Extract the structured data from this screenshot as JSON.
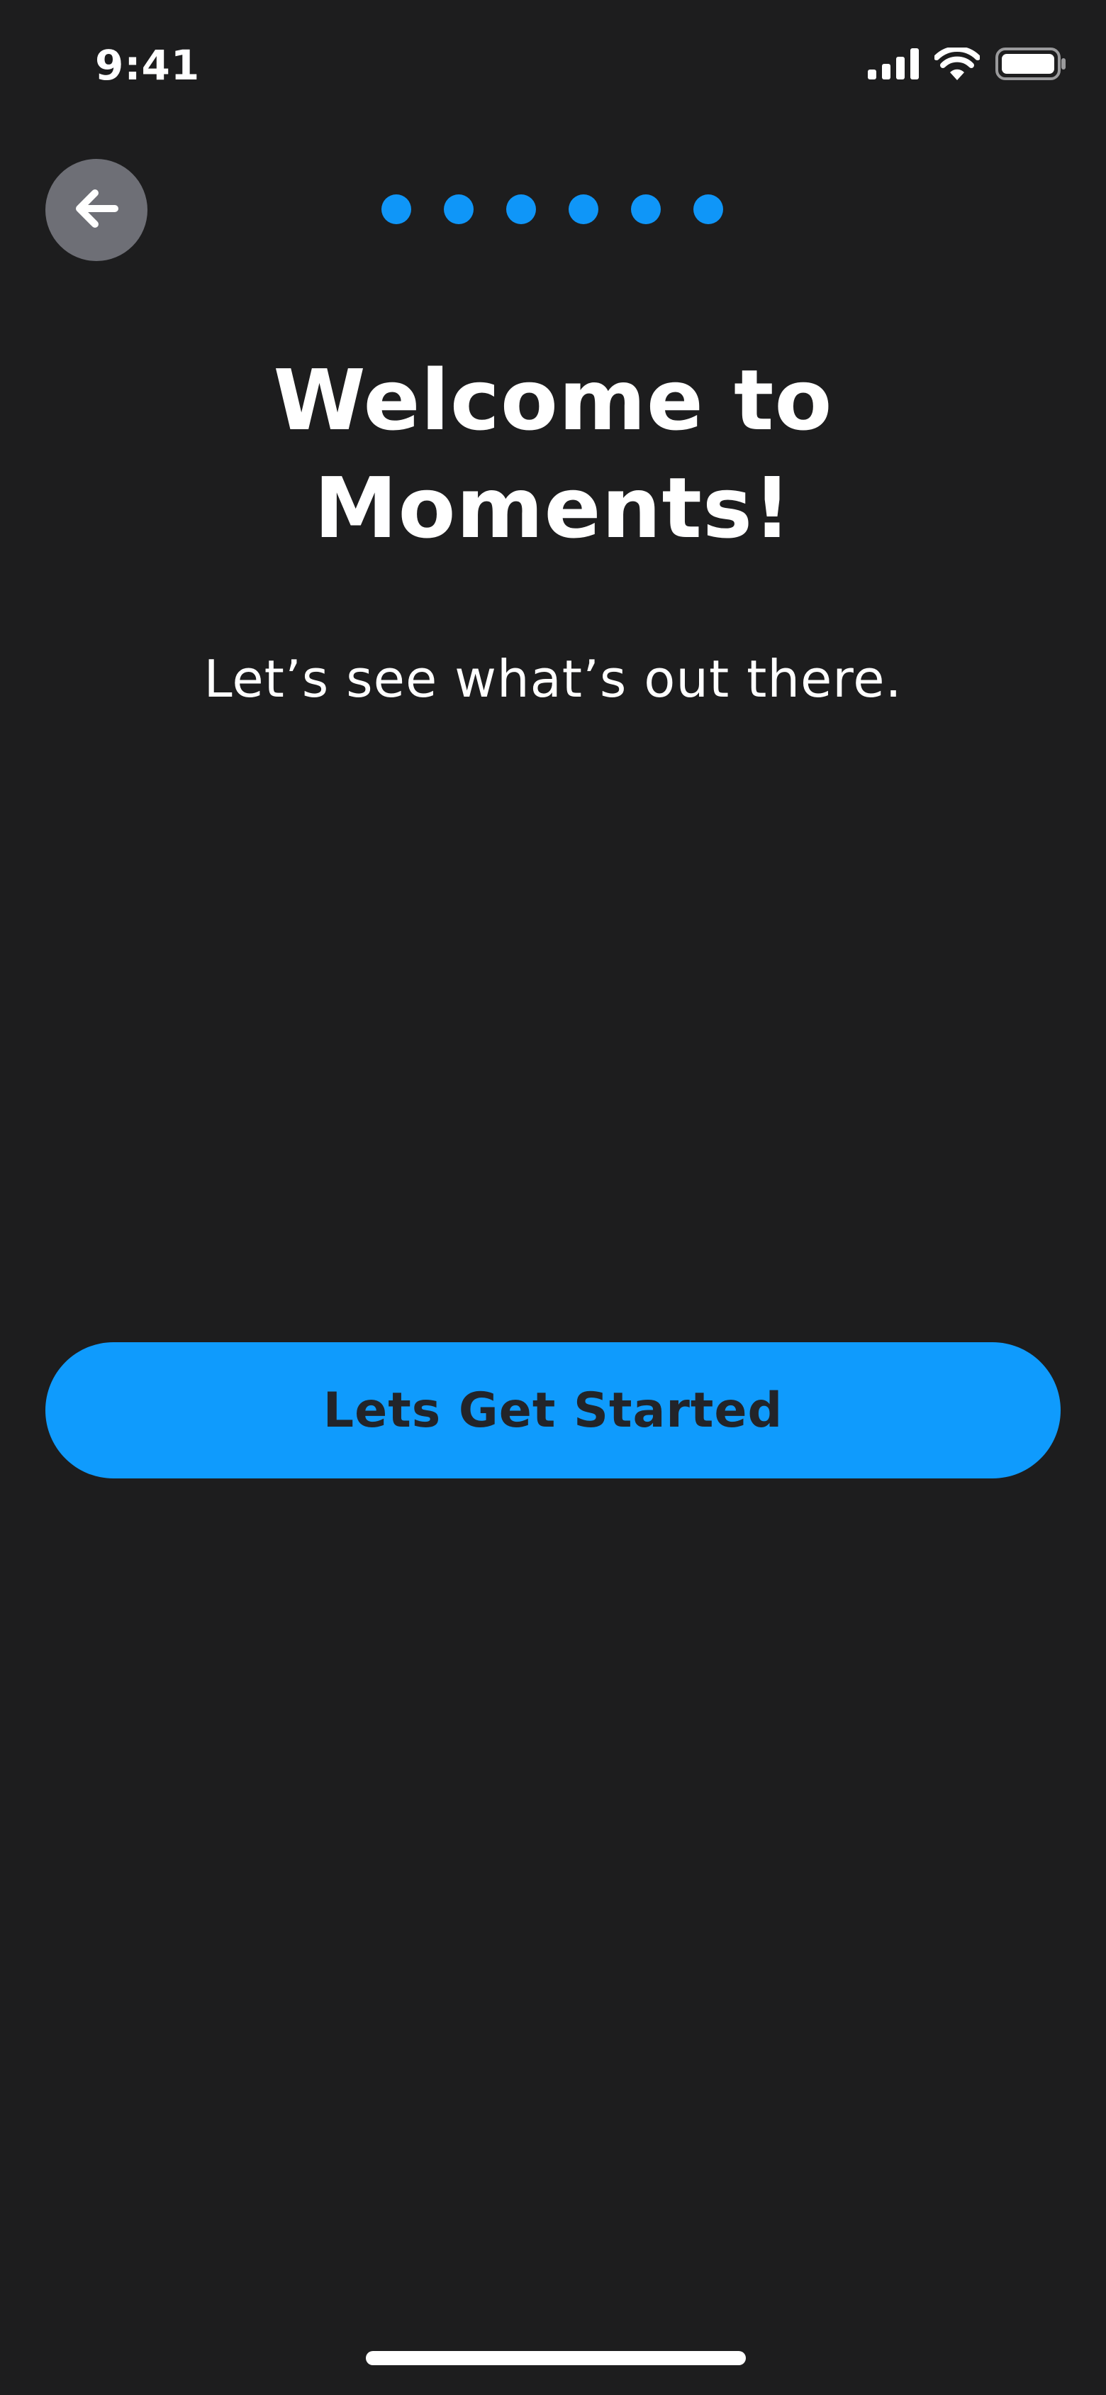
{
  "status_bar": {
    "time": "9:41",
    "icons": [
      "cellular-signal-icon",
      "wifi-icon",
      "battery-icon"
    ]
  },
  "header": {
    "back_icon": "arrow-left-icon",
    "progress_total": 6,
    "progress_color": "#0f96f8"
  },
  "main": {
    "title": "Welcome to\nMoments!",
    "subtitle": "Let’s see what’s out there."
  },
  "cta": {
    "label": "Lets Get Started",
    "color": "#0f9bfd"
  },
  "colors": {
    "background": "#1d1d1e",
    "back_button": "#6e6f76"
  }
}
